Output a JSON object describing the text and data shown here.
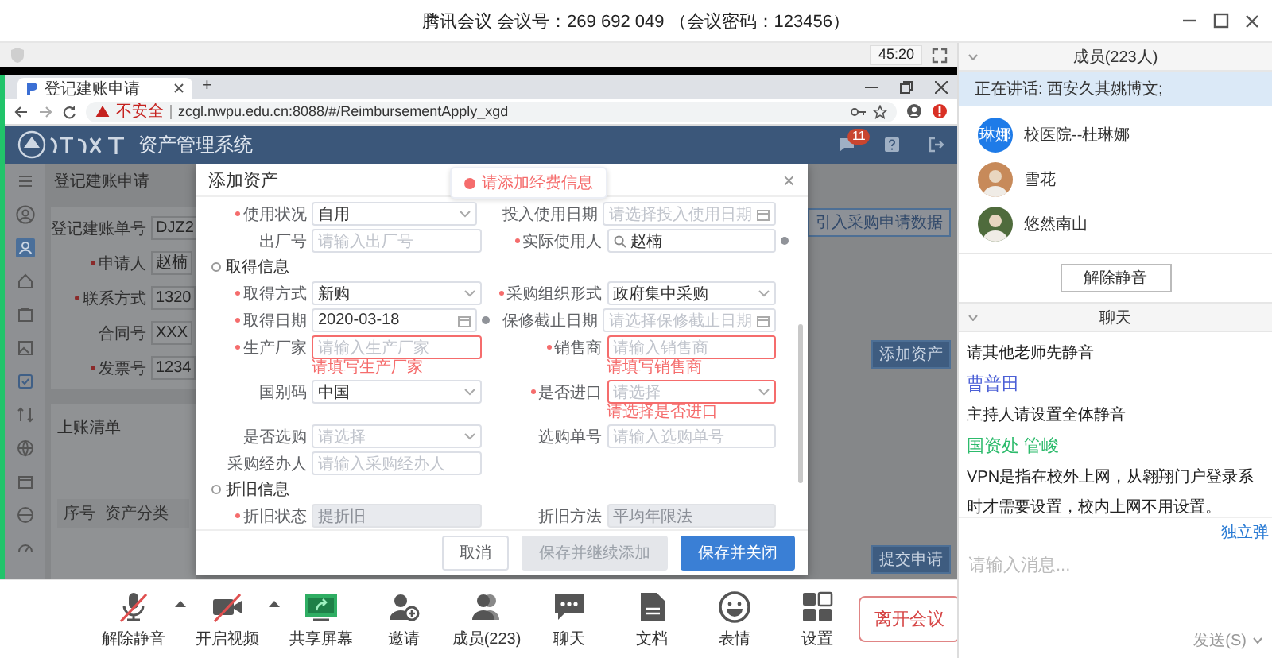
{
  "meeting": {
    "title": "腾讯会议 会议号：269 692 049 （会议密码：123456）",
    "timer": "45:20"
  },
  "browser": {
    "tab": "登记建账申请",
    "new_tab": "+",
    "warning": "不安全",
    "url": "zcgl.nwpu.edu.cn:8088/#/ReimbursementApply_xgd",
    "app_title": "资产管理系统",
    "badge": "11"
  },
  "page": {
    "title": "登记建账申请",
    "fields": [
      {
        "label": "登记建账单号",
        "required": false,
        "value": "DJZ2"
      },
      {
        "label": "申请人",
        "required": true,
        "value": "赵楠"
      },
      {
        "label": "联系方式",
        "required": true,
        "value": "1320"
      },
      {
        "label": "合同号",
        "required": false,
        "value": "XXX"
      },
      {
        "label": "发票号",
        "required": true,
        "value": "1234"
      }
    ],
    "list_title": "上账清单",
    "column_1": "序号",
    "column_2": "资产分类",
    "right_buttons": [
      {
        "label": "引入采购申请数据",
        "kind": "outline"
      },
      {
        "label": "添加资产",
        "kind": "primary"
      }
    ],
    "submit": "提交申请"
  },
  "dialog": {
    "title": "添加资产",
    "toast": "请添加经费信息",
    "close": "×",
    "rows": [
      {
        "kind": "pair",
        "items": [
          {
            "label": "使用状况",
            "required": true,
            "kind": "select",
            "value": "自用"
          },
          {
            "label": "投入使用日期",
            "required": false,
            "kind": "date",
            "placeholder": "请选择投入使用日期"
          }
        ]
      },
      {
        "kind": "pair",
        "items": [
          {
            "label": "出厂号",
            "required": false,
            "kind": "text",
            "placeholder": "请输入出厂号"
          },
          {
            "label": "实际使用人",
            "required": true,
            "kind": "search",
            "value": "赵楠",
            "info": true
          }
        ]
      },
      {
        "kind": "section",
        "title": "取得信息"
      },
      {
        "kind": "pair",
        "items": [
          {
            "label": "取得方式",
            "required": true,
            "kind": "select",
            "value": "新购"
          },
          {
            "label": "采购组织形式",
            "required": true,
            "kind": "select",
            "value": "政府集中采购"
          }
        ]
      },
      {
        "kind": "pair",
        "items": [
          {
            "label": "取得日期",
            "required": true,
            "kind": "date",
            "value": "2020-03-18",
            "info": true
          },
          {
            "label": "保修截止日期",
            "required": false,
            "kind": "date",
            "placeholder": "请选择保修截止日期"
          }
        ]
      },
      {
        "kind": "pair",
        "items": [
          {
            "label": "生产厂家",
            "required": true,
            "kind": "text",
            "placeholder": "请输入生产厂家",
            "error": "请填写生产厂家"
          },
          {
            "label": "销售商",
            "required": true,
            "kind": "text",
            "placeholder": "请输入销售商",
            "error": "请填写销售商"
          }
        ]
      },
      {
        "kind": "pair",
        "items": [
          {
            "label": "国别码",
            "required": false,
            "kind": "select",
            "value": "中国"
          },
          {
            "label": "是否进口",
            "required": true,
            "kind": "select",
            "placeholder": "请选择",
            "error": "请选择是否进口"
          }
        ]
      },
      {
        "kind": "pair",
        "items": [
          {
            "label": "是否选购",
            "required": false,
            "kind": "select",
            "placeholder": "请选择"
          },
          {
            "label": "选购单号",
            "required": false,
            "kind": "text",
            "placeholder": "请输入选购单号"
          }
        ]
      },
      {
        "kind": "pair",
        "items": [
          {
            "label": "采购经办人",
            "required": false,
            "kind": "text",
            "placeholder": "请输入采购经办人"
          }
        ]
      },
      {
        "kind": "section",
        "title": "折旧信息"
      },
      {
        "kind": "pair",
        "items": [
          {
            "label": "折旧状态",
            "required": true,
            "kind": "text",
            "placeholder": "提折旧",
            "disabled": true
          },
          {
            "label": "折旧方法",
            "required": false,
            "kind": "text",
            "placeholder": "平均年限法",
            "disabled": true
          }
        ]
      }
    ],
    "buttons": [
      {
        "label": "取消",
        "kind": "plain",
        "disabled": false
      },
      {
        "label": "保存并继续添加",
        "kind": "plain",
        "disabled": true
      },
      {
        "label": "保存并关闭",
        "kind": "primary",
        "disabled": false
      }
    ]
  },
  "toolbar": [
    {
      "label": "解除静音",
      "kind": "toggle",
      "on": false,
      "menu": true
    },
    {
      "label": "开启视频",
      "kind": "toggle",
      "on": false,
      "menu": true
    },
    {
      "label": "共享屏幕",
      "kind": "action"
    },
    {
      "label": "邀请",
      "kind": "action"
    },
    {
      "label": "成员(223)",
      "kind": "action"
    },
    {
      "label": "聊天",
      "kind": "action"
    },
    {
      "label": "文档",
      "kind": "action"
    },
    {
      "label": "表情",
      "kind": "action"
    },
    {
      "label": "设置",
      "kind": "action"
    }
  ],
  "leave_button": "离开会议",
  "panel": {
    "members_header": "成员(223人)",
    "speaking": "正在讲话: 西安久其姚博文;",
    "members": [
      {
        "name": "校医院--杜琳娜",
        "kind": "initials",
        "initials": "琳娜"
      },
      {
        "name": "雪花",
        "kind": "photo"
      },
      {
        "name": "悠然南山",
        "kind": "photo"
      }
    ],
    "unmute_button": "解除静音",
    "chat_header": "聊天",
    "messages": [
      {
        "lines": [
          "请其他老师先静音"
        ]
      },
      {
        "sender": "曹普田",
        "color": "#4b5fd6",
        "lines": [
          "主持人请设置全体静音"
        ]
      },
      {
        "sender": "国资处 管峻",
        "color": "#2dbb6c",
        "lines": [
          "VPN是指在校外上网，从翱翔门户登录系",
          "时才需要设置，校内上网不用设置。"
        ]
      }
    ],
    "popout_link": "独立弹",
    "input_placeholder": "请输入消息...",
    "send": "发送(S)"
  }
}
